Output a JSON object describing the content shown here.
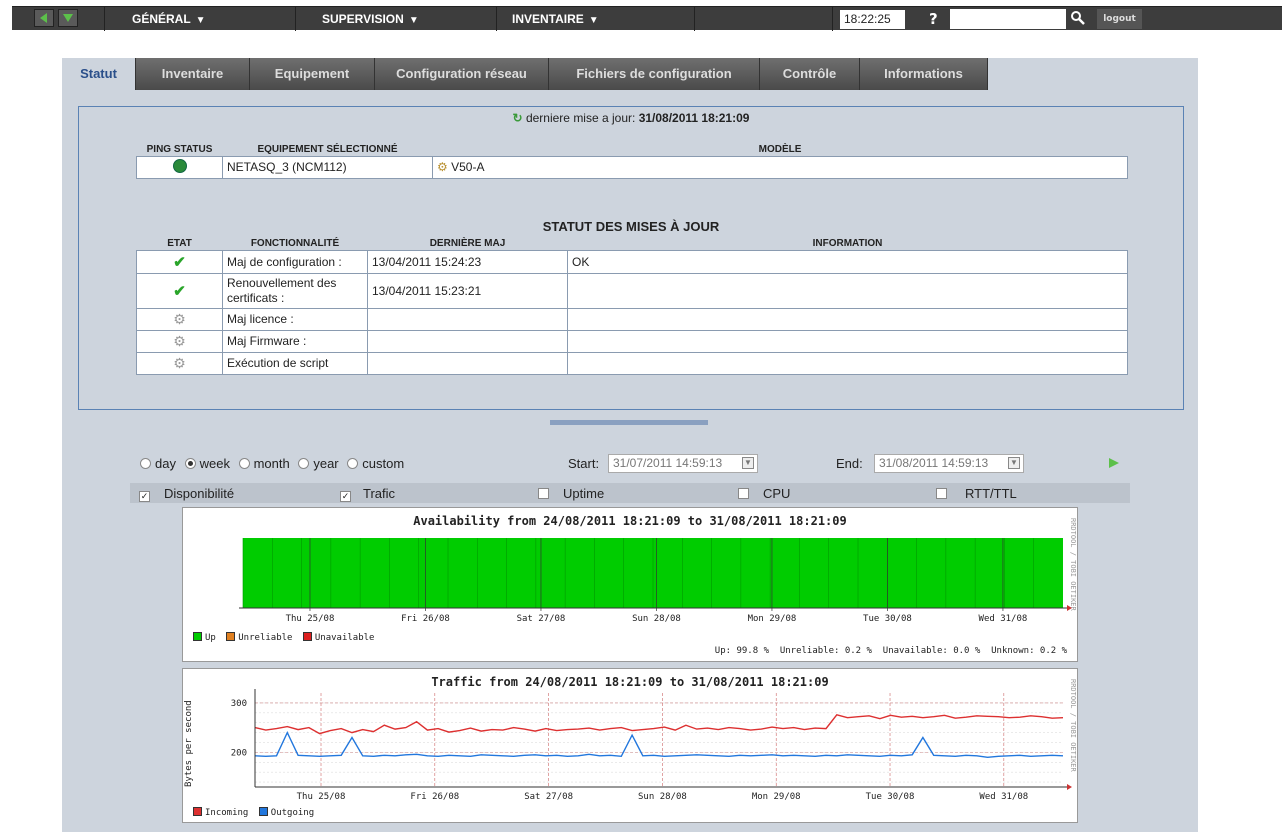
{
  "topbar": {
    "menus": [
      {
        "label": "GÉNÉRAL",
        "arrow": "▼"
      },
      {
        "label": "SUPERVISION",
        "arrow": "▼"
      },
      {
        "label": "INVENTAIRE",
        "arrow": "▼"
      }
    ],
    "time": "18:22:25",
    "help": "?",
    "search_placeholder": "",
    "logout": "logout"
  },
  "tabs": [
    {
      "label": "Statut",
      "active": true
    },
    {
      "label": "Inventaire"
    },
    {
      "label": "Equipement"
    },
    {
      "label": "Configuration réseau"
    },
    {
      "label": "Fichiers de configuration"
    },
    {
      "label": "Contrôle"
    },
    {
      "label": "Informations"
    }
  ],
  "status": {
    "update_label": "derniere mise a jour:",
    "update_value": "31/08/2011 18:21:09",
    "device_headers": [
      "PING STATUS",
      "EQUIPEMENT SÉLECTIONNÉ",
      "MODÈLE"
    ],
    "device_name": "NETASQ_3 (NCM112)",
    "model": "V50-A",
    "maj_title": "STATUT DES MISES À JOUR",
    "maj_headers": [
      "ETAT",
      "FONCTIONNALITÉ",
      "DERNIÈRE MAJ",
      "INFORMATION"
    ],
    "maj_rows": [
      {
        "state": "ok",
        "feature": "Maj de configuration :",
        "date": "13/04/2011 15:24:23",
        "info": "OK"
      },
      {
        "state": "ok",
        "feature": "Renouvellement des certificats :",
        "date": "13/04/2011 15:23:21",
        "info": ""
      },
      {
        "state": "pending",
        "feature": "Maj licence :",
        "date": "",
        "info": ""
      },
      {
        "state": "pending",
        "feature": "Maj Firmware :",
        "date": "",
        "info": ""
      },
      {
        "state": "pending",
        "feature": "Exécution de script",
        "date": "",
        "info": ""
      }
    ]
  },
  "period": {
    "options": [
      "day",
      "week",
      "month",
      "year",
      "custom"
    ],
    "selected": "week",
    "start_label": "Start:",
    "start_value": "31/07/2011 14:59:13",
    "end_label": "End:",
    "end_value": "31/08/2011 14:59:13"
  },
  "metrics": [
    {
      "label": "Disponibilité",
      "checked": true
    },
    {
      "label": "Trafic",
      "checked": true
    },
    {
      "label": "Uptime",
      "checked": false
    },
    {
      "label": "CPU",
      "checked": false
    },
    {
      "label": "RTT/TTL",
      "checked": false
    }
  ],
  "chart_data": [
    {
      "type": "area",
      "title": "Availability  from 24/08/2011 18:21:09 to 31/08/2011 18:21:09",
      "x_ticks": [
        "Thu 25/08",
        "Fri 26/08",
        "Sat 27/08",
        "Sun 28/08",
        "Mon 29/08",
        "Tue 30/08",
        "Wed 31/08"
      ],
      "legend": [
        "Up",
        "Unreliable",
        "Unavailable"
      ],
      "colors": {
        "Up": "#00cc00",
        "Unreliable": "#e08020",
        "Unavailable": "#dd2020"
      },
      "summary": "Up: 99.8 %  Unreliable: 0.2 %  Unavailable: 0.0 %  Unknown: 0.2 %",
      "watermark": "RRDTOOL / TOBI OETIKER"
    },
    {
      "type": "line",
      "title": "Traffic  from 24/08/2011 18:21:09 to 31/08/2011 18:21:09",
      "ylabel": "Bytes per second",
      "y_ticks": [
        "300",
        "200"
      ],
      "ylim": [
        130,
        320
      ],
      "x_ticks": [
        "Thu 25/08",
        "Fri 26/08",
        "Sat 27/08",
        "Sun 28/08",
        "Mon 29/08",
        "Tue 30/08",
        "Wed 31/08"
      ],
      "series": [
        {
          "name": "Incoming",
          "color": "#dd3030",
          "values": [
            250,
            245,
            248,
            252,
            246,
            250,
            238,
            244,
            248,
            240,
            246,
            242,
            255,
            247,
            250,
            262,
            245,
            248,
            241,
            244,
            249,
            243,
            246,
            245,
            250,
            247,
            243,
            248,
            244,
            246,
            247,
            249,
            245,
            248,
            250,
            244,
            246,
            248,
            251,
            245,
            255,
            247,
            249,
            246,
            250,
            248,
            245,
            247,
            251,
            248,
            250,
            246,
            249,
            248,
            276,
            270,
            272,
            274,
            268,
            275,
            271,
            273,
            270,
            272,
            275,
            269,
            271,
            274,
            273,
            272,
            270,
            271,
            274,
            272,
            269,
            270
          ]
        },
        {
          "name": "Outgoing",
          "color": "#2277dd",
          "values": [
            193,
            192,
            193,
            240,
            194,
            193,
            192,
            193,
            194,
            230,
            193,
            192,
            194,
            193,
            195,
            196,
            193,
            192,
            194,
            193,
            192,
            195,
            194,
            193,
            192,
            194,
            195,
            193,
            194,
            192,
            193,
            196,
            193,
            194,
            192,
            235,
            193,
            194,
            192,
            193,
            194,
            195,
            194,
            193,
            192,
            194,
            193,
            194,
            195,
            193,
            194,
            193,
            192,
            194,
            193,
            195,
            194,
            193,
            192,
            194,
            193,
            195,
            230,
            194,
            193,
            192,
            194,
            193,
            190,
            192,
            193,
            194,
            192,
            193,
            194,
            193
          ]
        }
      ],
      "legend": [
        "Incoming",
        "Outgoing"
      ],
      "watermark": "RRDTOOL / TOBI OETIKER"
    }
  ]
}
